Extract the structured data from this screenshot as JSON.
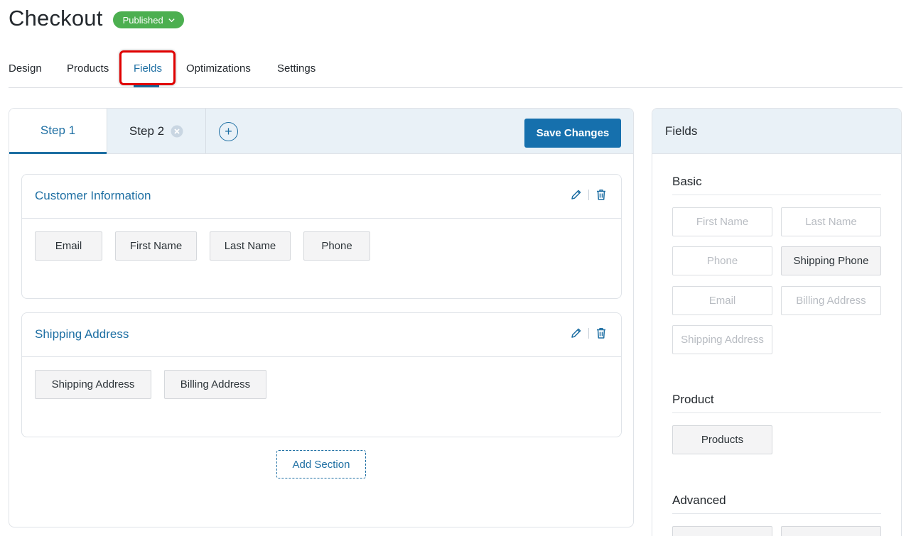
{
  "header": {
    "title": "Checkout",
    "status": "Published"
  },
  "tabs": [
    {
      "label": "Design"
    },
    {
      "label": "Products"
    },
    {
      "label": "Fields",
      "active": true
    },
    {
      "label": "Optimizations"
    },
    {
      "label": "Settings"
    }
  ],
  "steps": [
    {
      "label": "Step 1",
      "active": true
    },
    {
      "label": "Step 2",
      "removable": true
    }
  ],
  "toolbar": {
    "save_label": "Save Changes",
    "add_step_label": "+"
  },
  "sections": [
    {
      "title": "Customer Information",
      "fields": [
        "Email",
        "First Name",
        "Last Name",
        "Phone"
      ]
    },
    {
      "title": "Shipping Address",
      "fields": [
        "Shipping Address",
        "Billing Address"
      ]
    }
  ],
  "add_section_label": "Add Section",
  "fields_panel": {
    "title": "Fields",
    "groups": [
      {
        "title": "Basic",
        "items": [
          {
            "label": "First Name",
            "available": false
          },
          {
            "label": "Last Name",
            "available": false
          },
          {
            "label": "Phone",
            "available": false
          },
          {
            "label": "Shipping Phone",
            "available": true
          },
          {
            "label": "Email",
            "available": false
          },
          {
            "label": "Billing Address",
            "available": false
          },
          {
            "label": "Shipping Address",
            "available": false
          }
        ]
      },
      {
        "title": "Product",
        "items": [
          {
            "label": "Products",
            "available": true
          }
        ]
      },
      {
        "title": "Advanced",
        "items": []
      }
    ]
  },
  "colors": {
    "accent": "#1e6fa3",
    "button": "#1670ad",
    "badge": "#4caf50",
    "highlight": "#e00000"
  },
  "icons": [
    "chevron-down-icon",
    "remove-step-icon",
    "add-step-icon",
    "edit-icon",
    "trash-icon"
  ]
}
